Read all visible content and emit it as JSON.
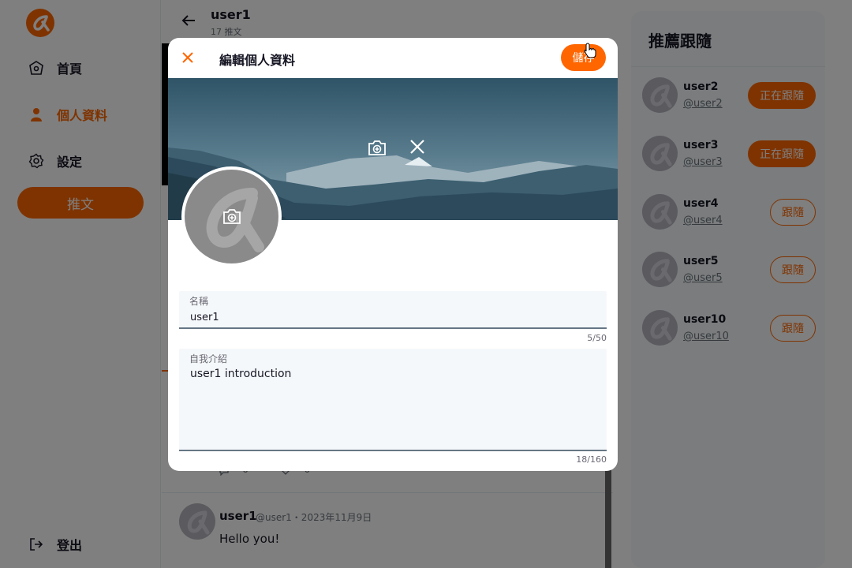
{
  "colors": {
    "brand": "#ff6600",
    "overlay": "rgba(0,0,0,0.5)"
  },
  "sidebar": {
    "items": [
      {
        "label": "首頁",
        "icon": "home-icon",
        "active": false
      },
      {
        "label": "個人資料",
        "icon": "user-icon",
        "active": true
      },
      {
        "label": "設定",
        "icon": "gear-icon",
        "active": false
      }
    ],
    "tweet_button": "推文",
    "logout": "登出"
  },
  "header": {
    "title": "user1",
    "subtitle": "17 推文"
  },
  "post": {
    "name": "user1",
    "meta": "@user1・2023年11月9日",
    "text": "Hello you!",
    "reply_count": "0",
    "like_count": "0"
  },
  "recommend": {
    "title": "推薦跟隨",
    "users": [
      {
        "name": "user2",
        "handle": "@user2",
        "button": "正在跟隨",
        "following": true
      },
      {
        "name": "user3",
        "handle": "@user3",
        "button": "正在跟隨",
        "following": true
      },
      {
        "name": "user4",
        "handle": "@user4",
        "button": "跟隨",
        "following": false
      },
      {
        "name": "user5",
        "handle": "@user5",
        "button": "跟隨",
        "following": false
      },
      {
        "name": "user10",
        "handle": "@user10",
        "button": "跟隨",
        "following": false
      }
    ]
  },
  "modal": {
    "title": "編輯個人資料",
    "save_label": "儲存",
    "name_field": {
      "label": "名稱",
      "value": "user1",
      "counter": "5/50"
    },
    "bio_field": {
      "label": "自我介紹",
      "value": "user1 introduction",
      "counter": "18/160"
    }
  }
}
